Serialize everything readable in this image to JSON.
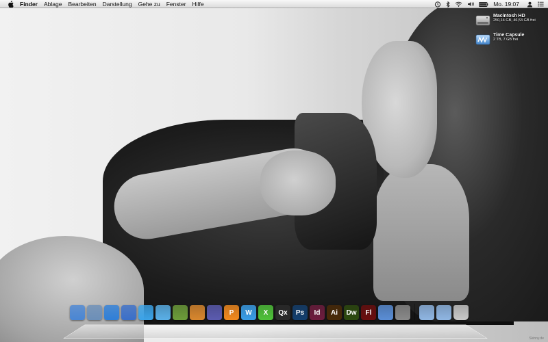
{
  "menubar": {
    "app_name": "Finder",
    "items": [
      "Ablage",
      "Bearbeiten",
      "Darstellung",
      "Gehe zu",
      "Fenster",
      "Hilfe"
    ],
    "clock": "Mo. 19:07"
  },
  "desktop": {
    "drives": [
      {
        "name": "Macintosh HD",
        "subtitle": "250,14 GB, 46,53 GB frei",
        "icon": "hard-drive-icon"
      },
      {
        "name": "Time Capsule",
        "subtitle": "2 TB, 7 GB frei",
        "icon": "time-capsule-icon"
      }
    ]
  },
  "dock": {
    "apps": [
      {
        "name": "finder",
        "icon": "finder-icon",
        "label": "",
        "color": "#4a86d4"
      },
      {
        "name": "preview",
        "icon": "preview-icon",
        "label": "",
        "color": "#6c8fb8"
      },
      {
        "name": "safari",
        "icon": "safari-icon",
        "label": "",
        "color": "#2f7fd8"
      },
      {
        "name": "itunes",
        "icon": "itunes-icon",
        "label": "",
        "color": "#3a6fc9"
      },
      {
        "name": "app-store",
        "icon": "app-store-icon",
        "label": "",
        "color": "#3ba3e8"
      },
      {
        "name": "ichat",
        "icon": "ichat-icon",
        "label": "",
        "color": "#5ab0e8"
      },
      {
        "name": "activity-monitor",
        "icon": "activity-monitor-icon",
        "label": "",
        "color": "#6d9d3a"
      },
      {
        "name": "keynote",
        "icon": "keynote-icon",
        "label": "",
        "color": "#d9872e"
      },
      {
        "name": "xcode",
        "icon": "xcode-icon",
        "label": "",
        "color": "#5b5bb0"
      },
      {
        "name": "pages",
        "icon": "pages-icon",
        "label": "P",
        "color": "#f28a1e"
      },
      {
        "name": "word",
        "icon": "word-icon",
        "label": "W",
        "color": "#3a9ee8"
      },
      {
        "name": "excel",
        "icon": "excel-icon",
        "label": "X",
        "color": "#4fc23a"
      },
      {
        "name": "quarkxpress",
        "icon": "quarkxpress-icon",
        "label": "Qx",
        "color": "#2b2b2b"
      },
      {
        "name": "photoshop",
        "icon": "photoshop-icon",
        "label": "Ps",
        "color": "#143f6e"
      },
      {
        "name": "indesign",
        "icon": "indesign-icon",
        "label": "Id",
        "color": "#6e1c3e"
      },
      {
        "name": "illustrator",
        "icon": "illustrator-icon",
        "label": "Ai",
        "color": "#4a2a08"
      },
      {
        "name": "dreamweaver",
        "icon": "dreamweaver-icon",
        "label": "Dw",
        "color": "#2d4a0f"
      },
      {
        "name": "flash",
        "icon": "flash-icon",
        "label": "Fl",
        "color": "#6a0e0e"
      },
      {
        "name": "screen-sharing",
        "icon": "screen-sharing-icon",
        "label": "",
        "color": "#5a8ed6"
      },
      {
        "name": "system-preferences",
        "icon": "system-preferences-icon",
        "label": "",
        "color": "#8a8a8a"
      }
    ],
    "stacks": [
      {
        "name": "applications-folder",
        "icon": "folder-icon",
        "color": "#8fb6e3"
      },
      {
        "name": "downloads-folder",
        "icon": "downloads-folder-icon",
        "color": "#8fb6e3"
      },
      {
        "name": "trash",
        "icon": "trash-icon",
        "color": "#c9c9c9"
      }
    ]
  },
  "watermark": "Skinny.de"
}
